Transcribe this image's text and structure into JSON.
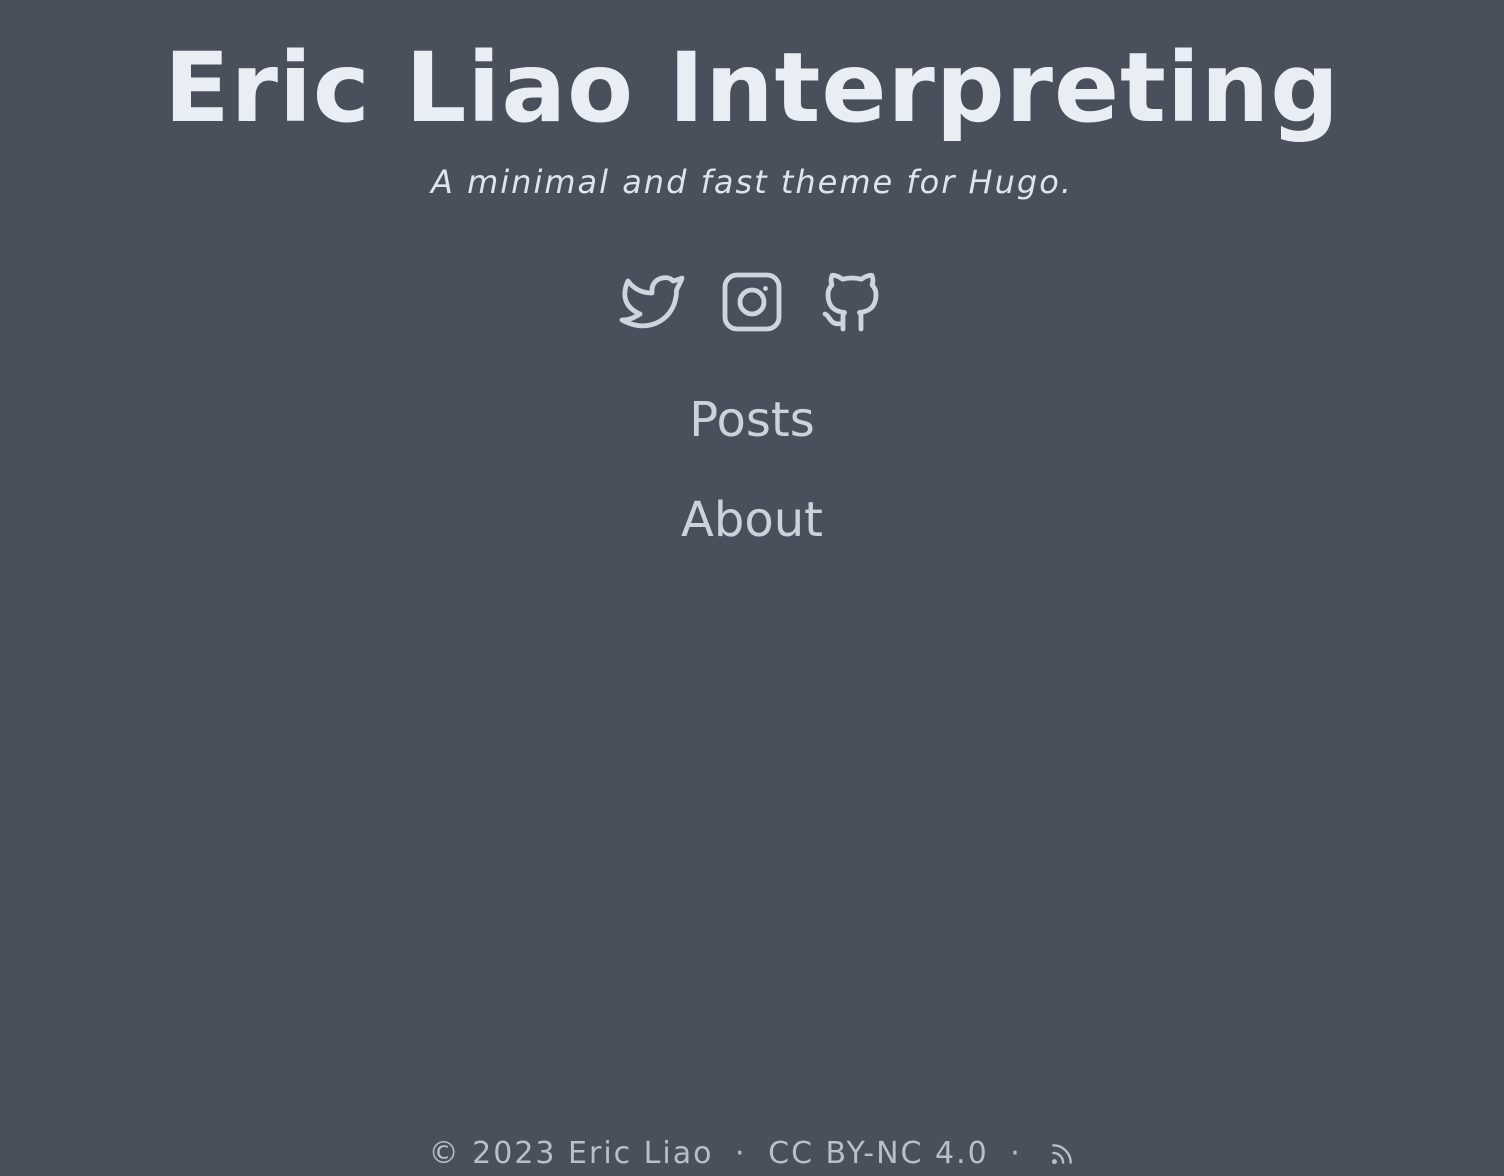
{
  "header": {
    "title": "Eric Liao Interpreting",
    "subtitle": "A minimal and fast theme for Hugo."
  },
  "social": [
    {
      "name": "twitter-icon"
    },
    {
      "name": "instagram-icon"
    },
    {
      "name": "github-icon"
    }
  ],
  "nav": {
    "items": [
      {
        "label": "Posts"
      },
      {
        "label": "About"
      }
    ]
  },
  "footer": {
    "copyright": "© 2023 Eric Liao",
    "separator_1": "·",
    "license": "CC BY-NC 4.0",
    "separator_2": "·",
    "rss_icon": "rss-icon"
  },
  "colors": {
    "background": "#4a4f5c",
    "title": "#e9eef5",
    "text": "#cdd2da",
    "footer": "#b9bec8"
  }
}
